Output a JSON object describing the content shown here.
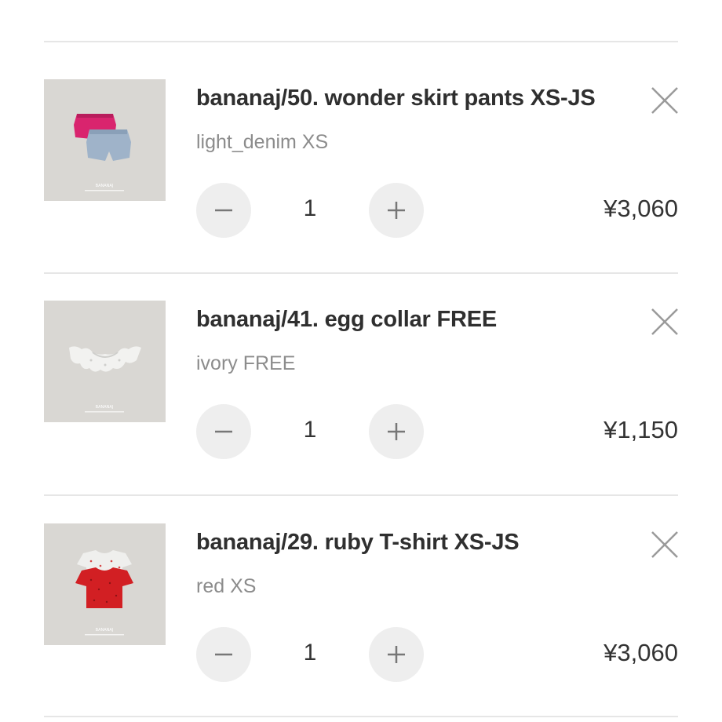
{
  "cart": {
    "items": [
      {
        "name": "bananaj/50. wonder skirt pants XS-JS",
        "variant": "light_denim XS",
        "quantity": "1",
        "price": "¥3,060",
        "thumbnail_icon": "skirt-pants-photo"
      },
      {
        "name": "bananaj/41. egg collar FREE",
        "variant": "ivory FREE",
        "quantity": "1",
        "price": "¥1,150",
        "thumbnail_icon": "collar-photo"
      },
      {
        "name": "bananaj/29. ruby T-shirt XS-JS",
        "variant": "red XS",
        "quantity": "1",
        "price": "¥3,060",
        "thumbnail_icon": "tshirt-photo"
      }
    ]
  },
  "colors": {
    "background": "#ffffff",
    "divider": "#e6e6e6",
    "button_bg": "#eeeeee",
    "title_text": "#2f2f2f",
    "variant_text": "#8c8c8c",
    "icon_gray": "#9a9a9a"
  }
}
